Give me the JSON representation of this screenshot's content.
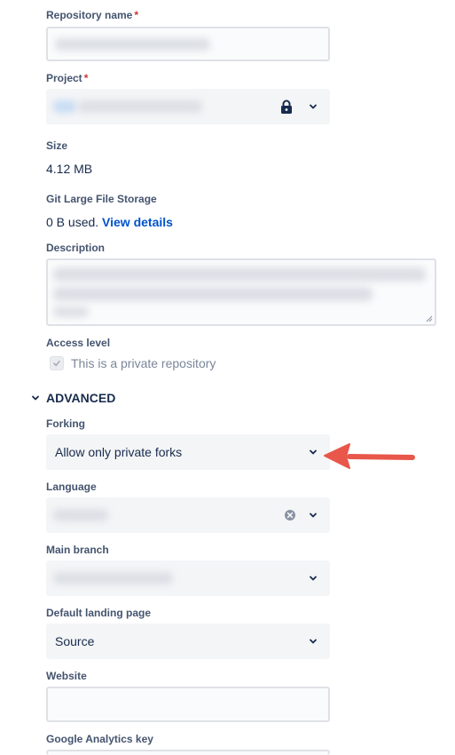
{
  "repo_name": {
    "label": "Repository name",
    "required_mark": "*"
  },
  "project": {
    "label": "Project",
    "required_mark": "*"
  },
  "size": {
    "label": "Size",
    "value": "4.12 MB"
  },
  "lfs": {
    "label": "Git Large File Storage",
    "used": "0 B used.",
    "link": "View details"
  },
  "description": {
    "label": "Description"
  },
  "access": {
    "label": "Access level",
    "checkbox_label": "This is a private repository",
    "checked": true
  },
  "advanced": {
    "label": "ADVANCED",
    "expanded": true
  },
  "forking": {
    "label": "Forking",
    "value": "Allow only private forks"
  },
  "language": {
    "label": "Language"
  },
  "main_branch": {
    "label": "Main branch"
  },
  "landing": {
    "label": "Default landing page",
    "value": "Source"
  },
  "website": {
    "label": "Website",
    "value": ""
  },
  "ga": {
    "label": "Google Analytics key"
  },
  "colors": {
    "link": "#0052cc",
    "required": "#c9372c",
    "arrow": "#e8574a",
    "field_bg": "#f4f5f7"
  },
  "icons": [
    "lock-icon",
    "chevron-down-icon",
    "clear-icon",
    "arrow-icon"
  ]
}
